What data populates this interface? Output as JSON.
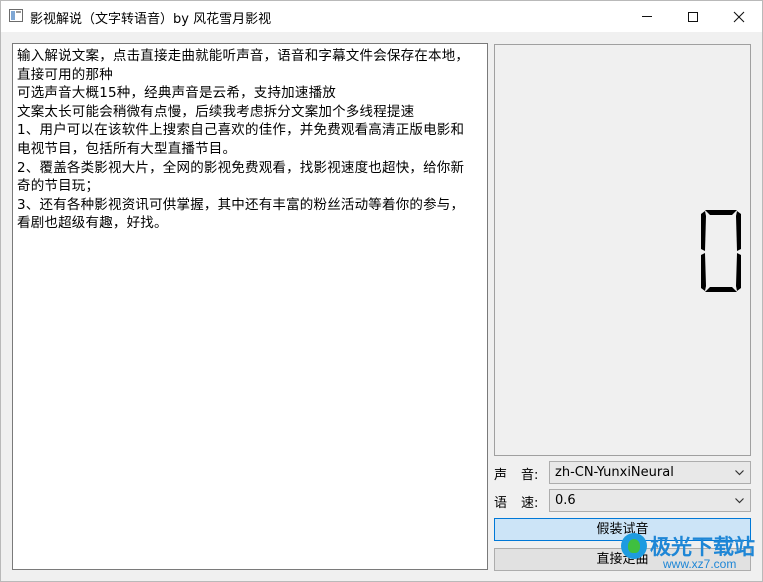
{
  "window": {
    "title": "影视解说（文字转语音）by 风花雪月影视"
  },
  "editor": {
    "lines": [
      "输入解说文案，点击直接走曲就能听声音，语音和字幕文件会保存在本地，",
      "直接可用的那种",
      "可选声音大概15种，经典声音是云希，支持加速播放",
      "文案太长可能会稍微有点慢，后续我考虑拆分文案加个多线程提速",
      "1、用户可以在该软件上搜索自己喜欢的佳作，并免费观看高清正版电影和",
      "电视节目，包括所有大型直播节目。",
      "2、覆盖各类影视大片，全网的影视免费观看，找影视速度也超快，给你新",
      "奇的节目玩；",
      "3、还有各种影视资讯可供掌握，其中还有丰富的粉丝活动等着你的参与，",
      "看剧也超级有趣，好找。"
    ]
  },
  "display": {
    "digit": "0"
  },
  "form": {
    "voice_label_a": "声",
    "voice_label_b": "音:",
    "voice_value": "zh-CN-YunxiNeural",
    "speed_label_a": "语",
    "speed_label_b": "速:",
    "speed_value": "0.6"
  },
  "buttons": {
    "preview": "假装试音",
    "direct": "直接走曲"
  },
  "watermark": {
    "name": "极光下载站",
    "url": "www.xz7.com"
  },
  "colors": {
    "accent": "#0078d7",
    "preview_bg": "#cce4f7",
    "watermark": "#1e86d6"
  }
}
